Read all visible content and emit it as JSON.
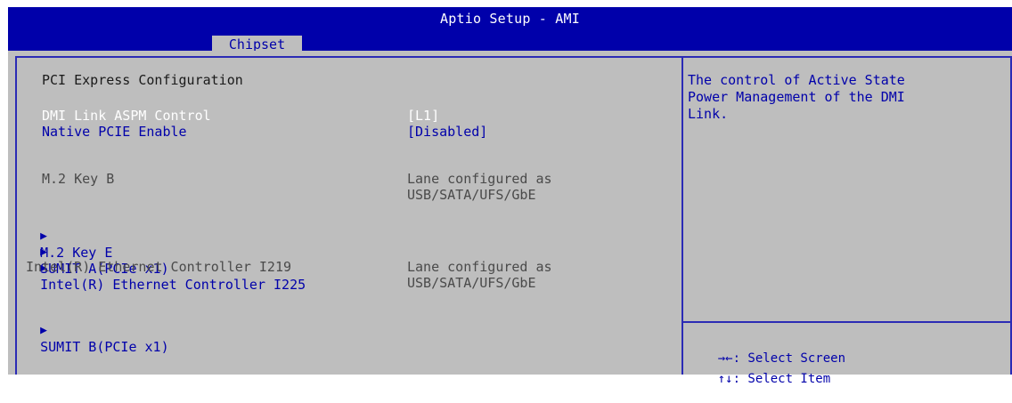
{
  "app": {
    "title": "Aptio Setup - AMI"
  },
  "tabs": [
    {
      "label": "Chipset"
    }
  ],
  "page": {
    "title": "PCI Express Configuration",
    "options": {
      "dmi_aspm": {
        "label": "DMI Link ASPM Control",
        "value": "[L1]"
      },
      "native_pcie": {
        "label": "Native PCIE Enable",
        "value": "[Disabled]"
      }
    },
    "info": {
      "m2_key_b": {
        "label": "M.2 Key B",
        "value_line1": "Lane configured as",
        "value_line2": "USB/SATA/UFS/GbE"
      },
      "i219": {
        "label": "Intel(R) Ethernet Controller I219",
        "value_line1": "Lane configured as",
        "value_line2": "USB/SATA/UFS/GbE"
      }
    },
    "submenus": {
      "m2_key_e": "M.2 Key E",
      "sumit_a": "SUMIT A(PCIe x1)",
      "i225": "Intel(R) Ethernet Controller I225",
      "sumit_b": "SUMIT B(PCIe x1)"
    },
    "submenu_arrow": "▶"
  },
  "help": {
    "line1": "The control of Active State",
    "line2": "Power Management of the DMI",
    "line3": "Link."
  },
  "keys": [
    {
      "key": "→←",
      "action": ": Select Screen"
    },
    {
      "key": "↑↓",
      "action": ": Select Item"
    }
  ],
  "colors": {
    "title_bar": "#0000aa",
    "panel": "#bebebe",
    "selected_text": "#ffffff",
    "option_text": "#0000aa",
    "static_text": "#1a1a1a"
  }
}
